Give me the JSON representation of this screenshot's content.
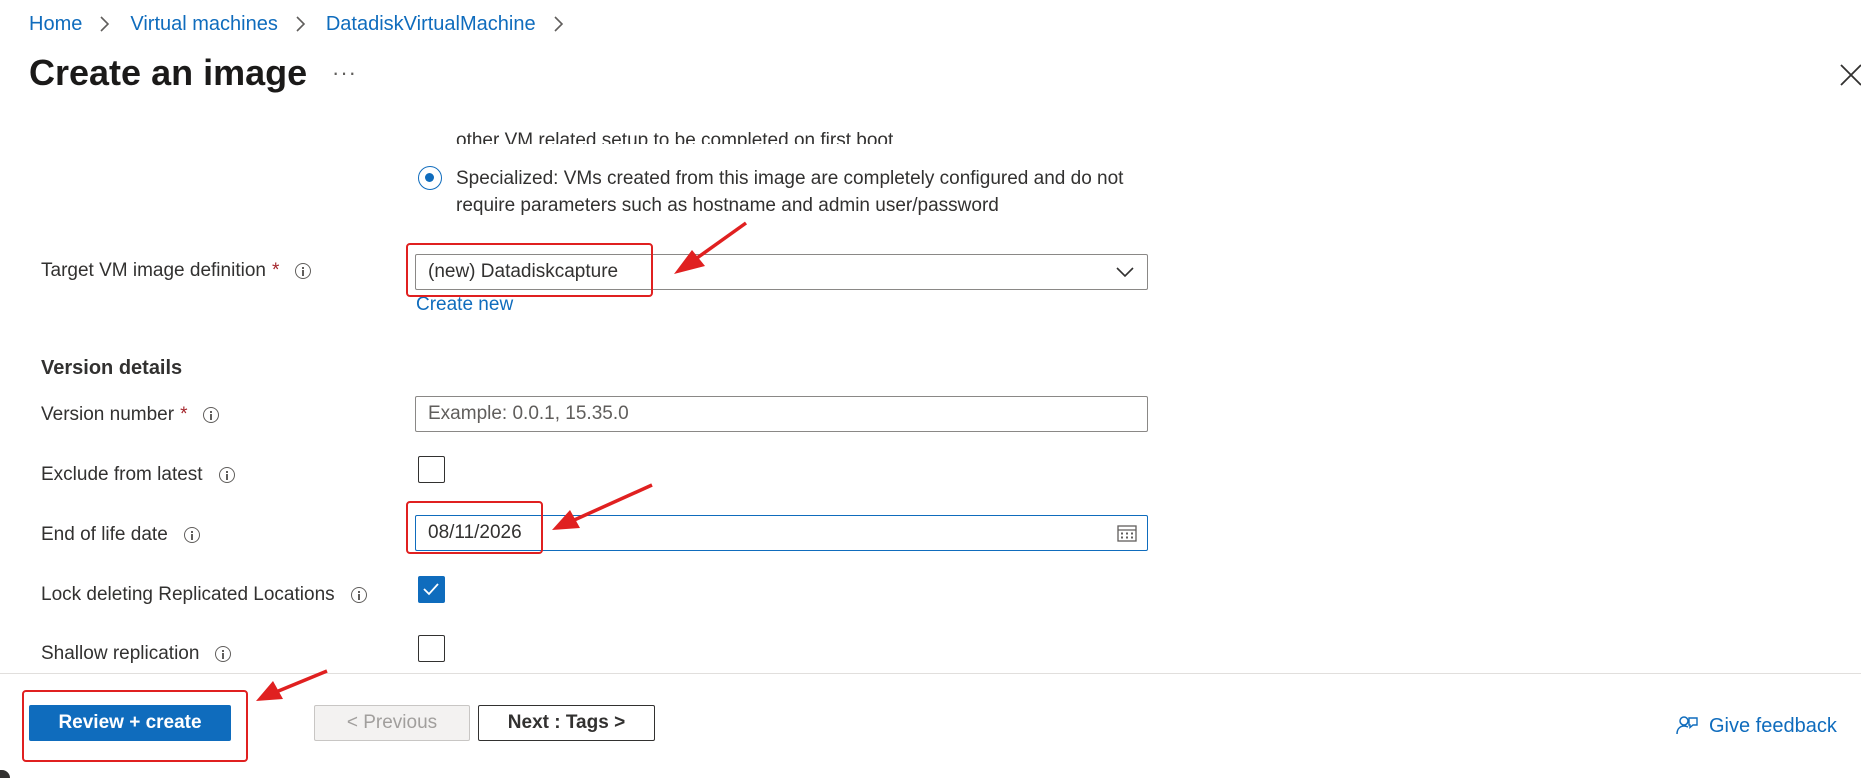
{
  "breadcrumb": {
    "items": [
      "Home",
      "Virtual machines",
      "DatadiskVirtualMachine"
    ]
  },
  "header": {
    "title": "Create an image",
    "more_label": "···"
  },
  "os_state": {
    "generalized_tail": "other VM related setup to be completed on first boot",
    "specialized_line1": "Specialized: VMs created from this image are completely configured and do not",
    "specialized_line2": "require parameters such as hostname and admin user/password",
    "selected": "Specialized"
  },
  "target_definition": {
    "label": "Target VM image definition",
    "required_mark": "*",
    "value": "(new) Datadiskcapture",
    "create_new": "Create new"
  },
  "version_details": {
    "heading": "Version details",
    "version_number": {
      "label": "Version number",
      "required_mark": "*",
      "placeholder": "Example: 0.0.1, 15.35.0"
    },
    "exclude_from_latest": {
      "label": "Exclude from latest",
      "checked": false
    },
    "end_of_life_date": {
      "label": "End of life date",
      "value": "08/11/2026"
    },
    "lock_deleting": {
      "label": "Lock deleting Replicated Locations",
      "checked": true
    },
    "shallow_replication": {
      "label": "Shallow replication",
      "checked": false
    }
  },
  "footer": {
    "review_create": "Review + create",
    "previous": "< Previous",
    "next": "Next : Tags >",
    "feedback": "Give feedback"
  },
  "colors": {
    "accent": "#0f6cbd",
    "annotation": "#e02020",
    "required": "#a4262c"
  },
  "icons": [
    "chevron-right-icon",
    "close-icon",
    "info-icon",
    "chevron-down-icon",
    "calendar-icon",
    "checkmark-icon",
    "feedback-icon",
    "arrow-annotation"
  ]
}
